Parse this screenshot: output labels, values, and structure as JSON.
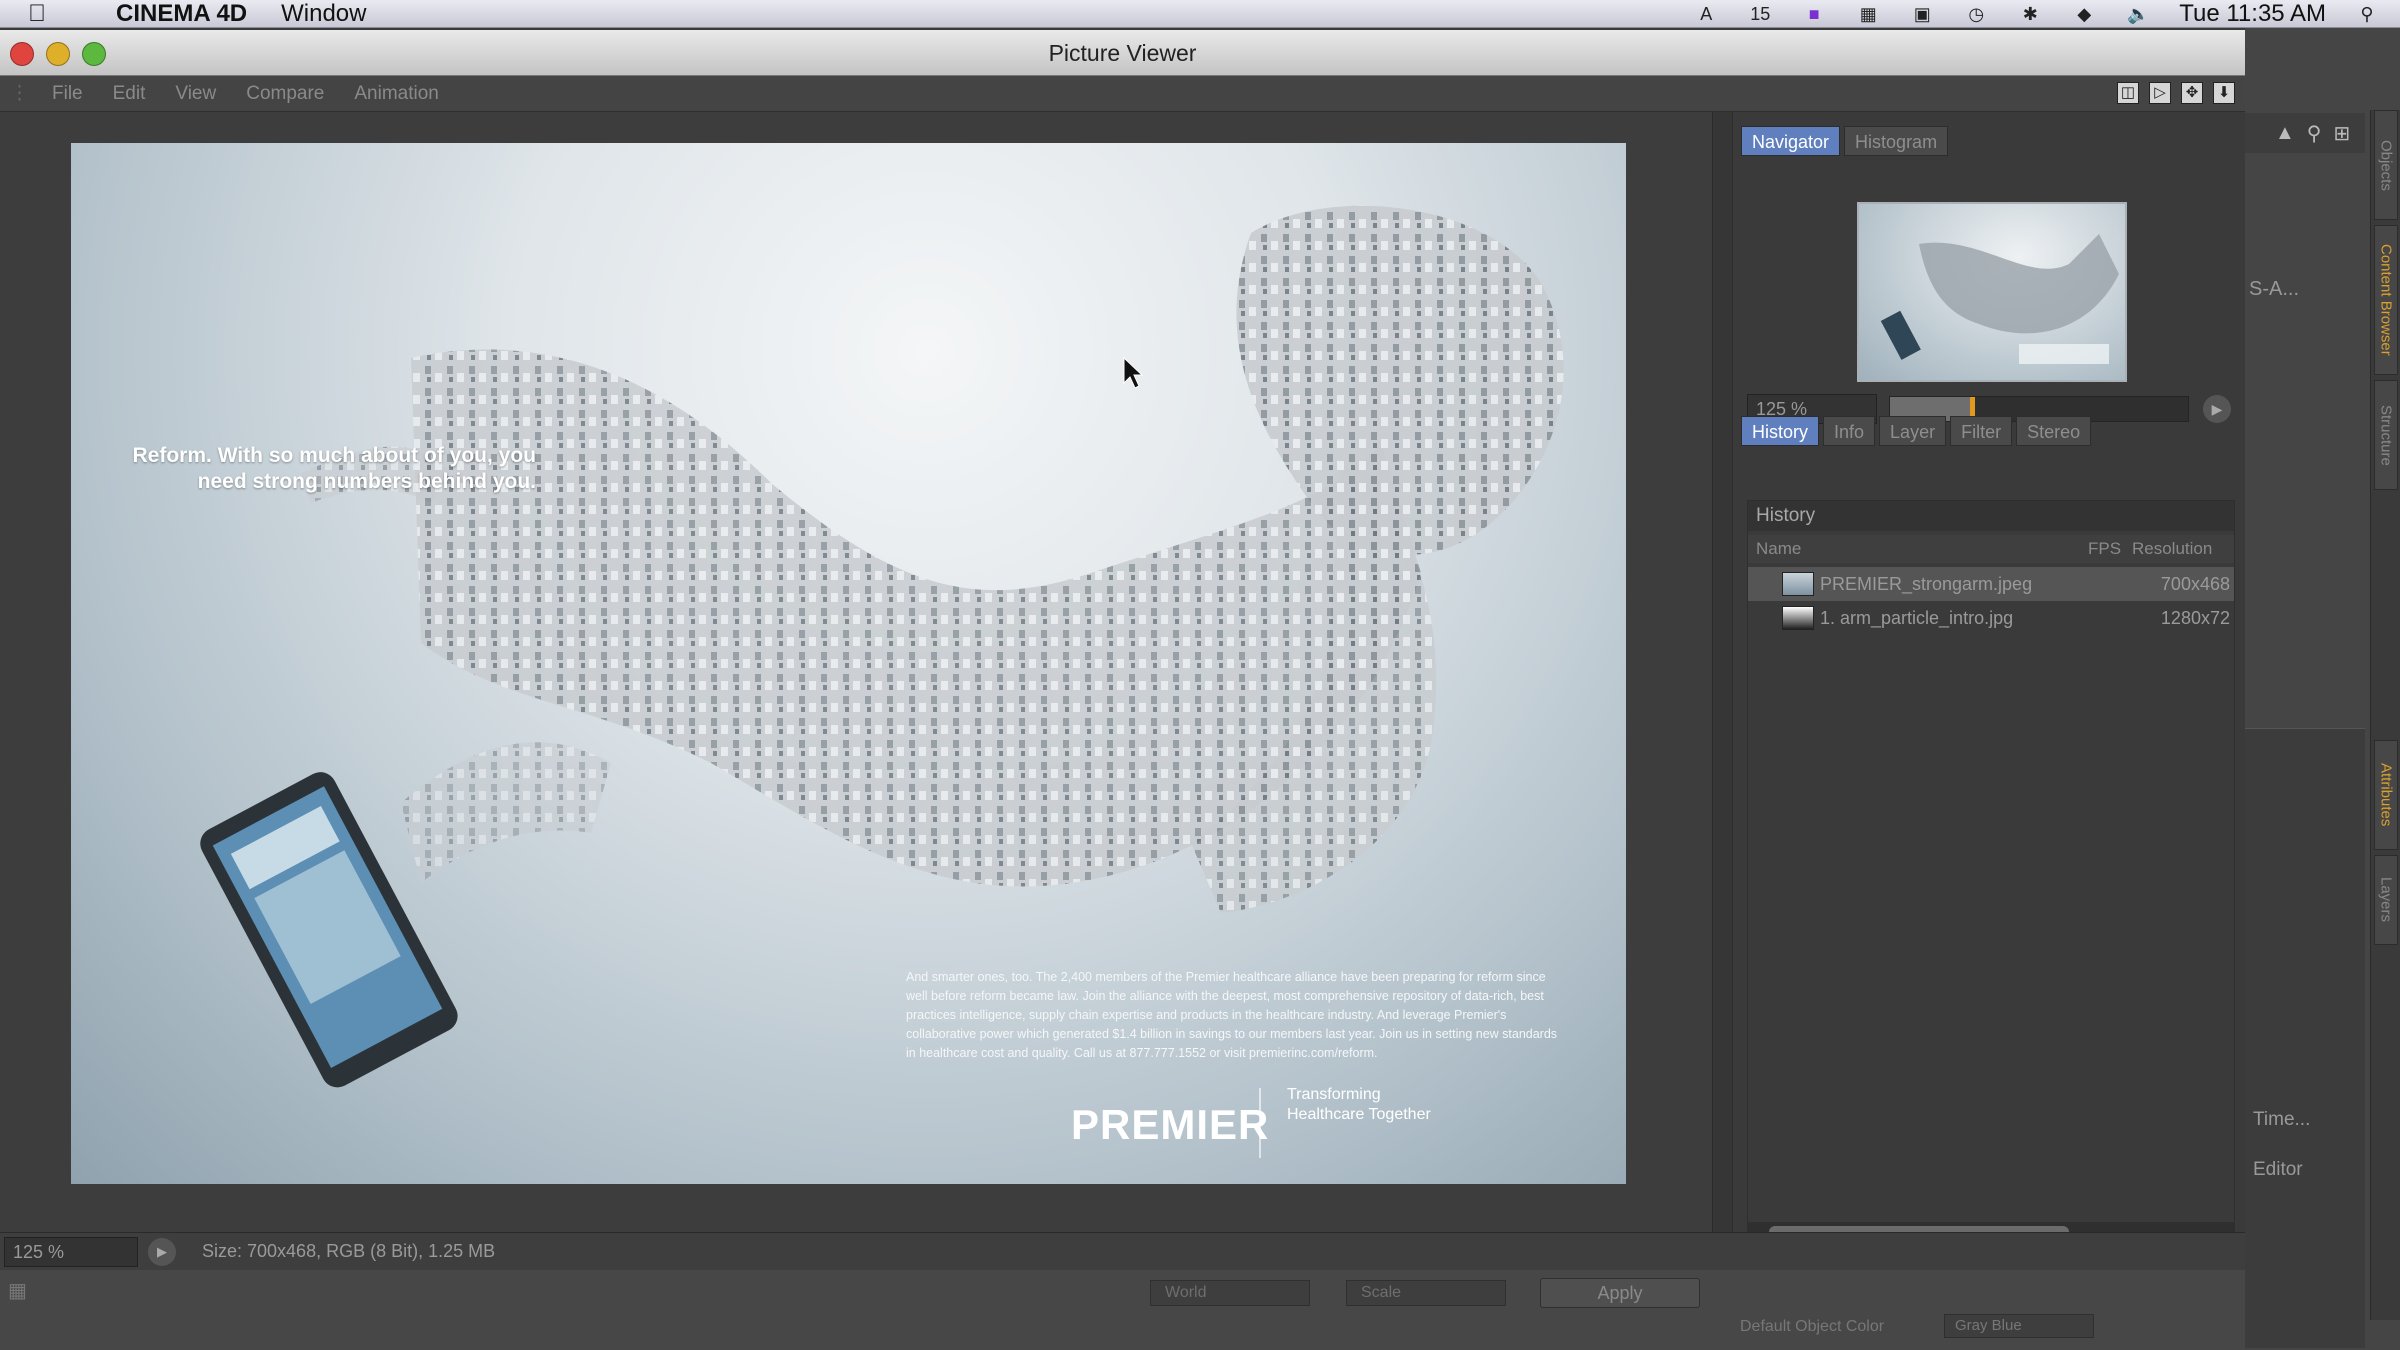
{
  "menubar": {
    "apple_icon": "apple-icon",
    "app_name": "CINEMA 4D",
    "items": [
      "Window"
    ],
    "battery_text": "15",
    "clock": "Tue 11:35 AM"
  },
  "window": {
    "title": "Picture Viewer",
    "menu": [
      "File",
      "Edit",
      "View",
      "Compare",
      "Animation"
    ]
  },
  "ad": {
    "headline": "Reform. With so much about of you, you need strong numbers behind you.",
    "body": "And smarter ones, too. The 2,400 members of the Premier healthcare alliance have been preparing for reform since well before reform became law. Join the alliance with the deepest, most comprehensive repository of data-rich, best practices intelligence, supply chain expertise and products in the healthcare industry. And leverage Premier's collaborative power which generated $1.4 billion in savings to our members last year. Join us in setting new standards in healthcare cost and quality. Call us at 877.777.1552 or visit premierinc.com/reform.",
    "logo": "PREMIER",
    "tagline": "Transforming Healthcare Together"
  },
  "panel": {
    "tabs_top": [
      "Navigator",
      "Histogram"
    ],
    "active_top": "Navigator",
    "zoom_value": "125 %",
    "zoom_level_fraction": 0.27,
    "tabs_bottom": [
      "History",
      "Info",
      "Layer",
      "Filter",
      "Stereo"
    ],
    "active_bottom": "History",
    "history": {
      "title": "History",
      "columns": {
        "name": "Name",
        "fps": "FPS",
        "resolution": "Resolution"
      },
      "rows": [
        {
          "name": "PREMIER_strongarm.jpeg",
          "resolution": "700x468"
        },
        {
          "name": "1. arm_particle_intro.jpg",
          "resolution": "1280x72"
        }
      ]
    }
  },
  "status": {
    "zoom_value": "125 %",
    "info": "Size: 700x468, RGB (8 Bit), 1.25 MB"
  },
  "bottom": {
    "select1": "World",
    "select2": "Scale",
    "apply": "Apply",
    "obj_color_label": "Default Object Color",
    "obj_color_value": "Gray Blue"
  },
  "c4d_right": {
    "label": "S-A...",
    "rows": [
      "Editor",
      "Time..."
    ],
    "vtabs": [
      "Objects",
      "Content Browser",
      "Structure",
      "Attributes",
      "Layers"
    ]
  },
  "colors": {
    "active_tab": "#5f7fbf",
    "slider_knob": "#e39a1c",
    "traffic_red": "#e0443e",
    "traffic_yellow": "#deb02a",
    "traffic_green": "#5cb83f"
  }
}
